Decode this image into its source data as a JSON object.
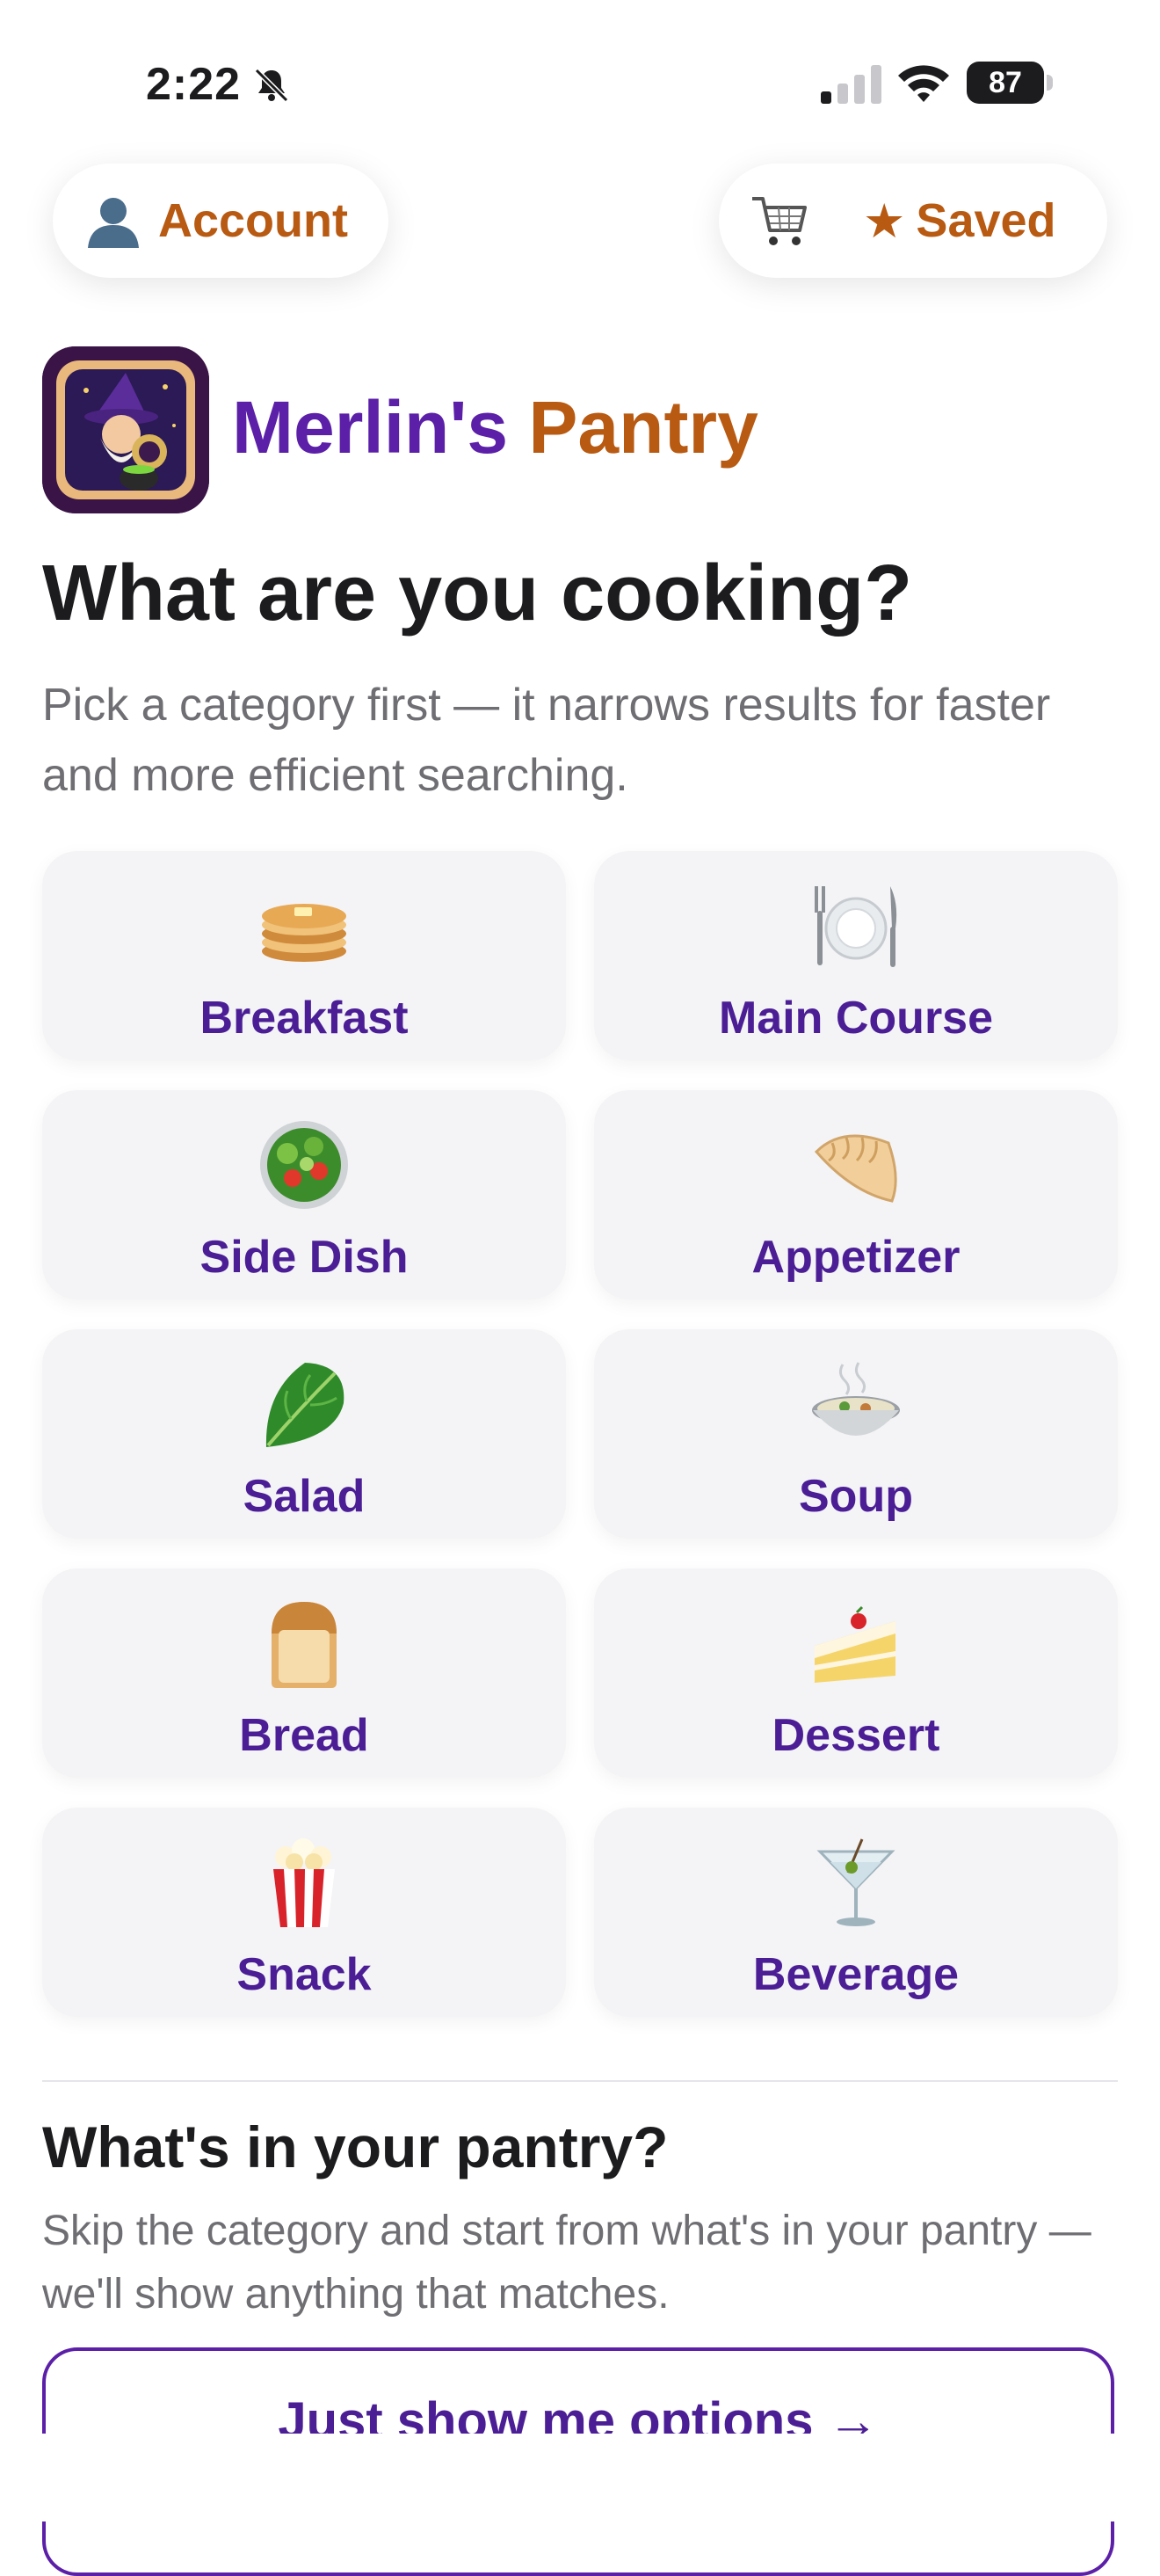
{
  "status_bar": {
    "time": "2:22",
    "battery": "87"
  },
  "header": {
    "account_label": "Account",
    "saved_label": "Saved"
  },
  "brand": {
    "name_part1": "Merlin's",
    "name_part2": "Pantry"
  },
  "hero": {
    "title": "What are you cooking?",
    "subtitle": "Pick a category first — it narrows results for faster and more efficient searching."
  },
  "categories": [
    {
      "label": "Breakfast",
      "icon": "pancakes-icon"
    },
    {
      "label": "Main Course",
      "icon": "plate-fork-knife-icon"
    },
    {
      "label": "Side Dish",
      "icon": "green-salad-bowl-icon"
    },
    {
      "label": "Appetizer",
      "icon": "dumpling-icon"
    },
    {
      "label": "Salad",
      "icon": "leafy-green-icon"
    },
    {
      "label": "Soup",
      "icon": "steaming-bowl-icon"
    },
    {
      "label": "Bread",
      "icon": "bread-icon"
    },
    {
      "label": "Dessert",
      "icon": "cake-slice-icon"
    },
    {
      "label": "Snack",
      "icon": "popcorn-icon"
    },
    {
      "label": "Beverage",
      "icon": "cocktail-glass-icon"
    }
  ],
  "pantry": {
    "title": "What's in your pantry?",
    "subtitle": "Skip the category and start from what's in your pantry — we'll show anything that matches.",
    "button_label": "Just show me options →"
  },
  "colors": {
    "accent_orange": "#b85a12",
    "accent_purple": "#4b1e95",
    "card_bg": "#f4f4f6"
  }
}
